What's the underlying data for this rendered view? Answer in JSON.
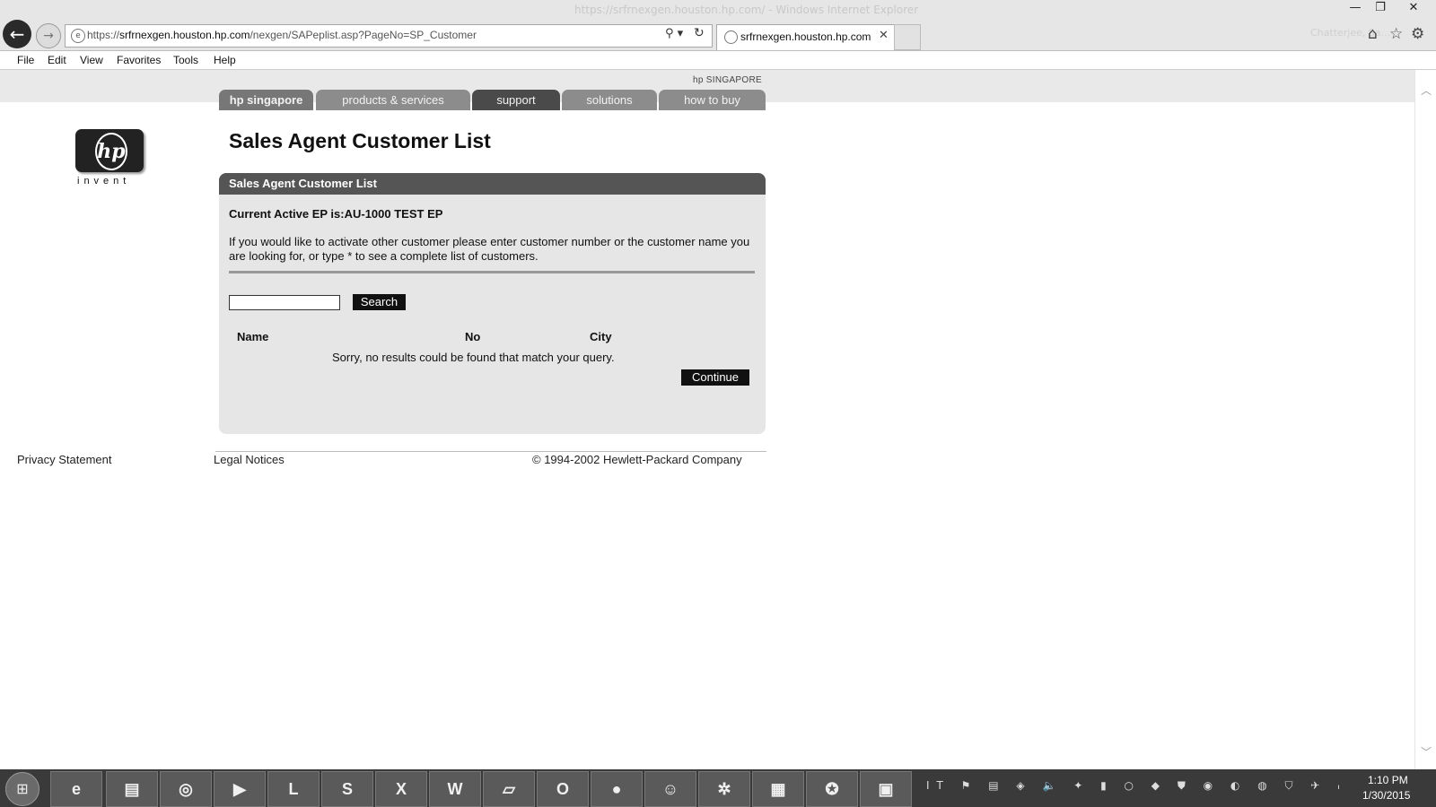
{
  "browser": {
    "window_title": "https://srfrnexgen.houston.hp.com/ - Windows Internet Explorer",
    "url_prefix": "https://",
    "url_domain": "srfrnexgen.houston.hp.com",
    "url_path": "/nexgen/SAPeplist.asp?PageNo=SP_Customer",
    "tab_title": "srfrnexgen.houston.hp.com",
    "user_name": "Chatterjee, Sa..."
  },
  "menu": {
    "file": "File",
    "edit": "Edit",
    "view": "View",
    "favorites": "Favorites",
    "tools": "Tools",
    "help": "Help"
  },
  "site": {
    "region_label": "hp SINGAPORE",
    "nav": {
      "hp_singapore": "hp singapore",
      "products_services": "products & services",
      "support": "support",
      "solutions": "solutions",
      "how_to_buy": "how to buy"
    },
    "logo_tagline": "invent"
  },
  "main": {
    "title": "Sales Agent Customer List",
    "panel_header": "Sales Agent Customer List",
    "active_ep": "Current Active EP is:AU-1000 TEST EP",
    "instructions": "If you would like to activate other customer please enter customer number or the customer name you are looking for, or type * to see a complete list of customers.",
    "search_value": "",
    "search_button": "Search",
    "columns": [
      "Name",
      "No",
      "City"
    ],
    "no_results": "Sorry, no results could be found that match your query.",
    "continue_button": "Continue"
  },
  "footer": {
    "privacy": "Privacy Statement",
    "legal": "Legal Notices",
    "copyright": "© 1994-2002 Hewlett-Packard Company"
  },
  "taskbar": {
    "apps": [
      "Internet Explorer",
      "File Explorer",
      "Chrome",
      "Media Player",
      "Lync",
      "Skype",
      "Excel",
      "Word",
      "Notepad",
      "Outlook",
      "Firefox",
      "Contacts",
      "Settings",
      "WinRAR",
      "Help",
      "Clipboard"
    ],
    "app_letters": {
      "lync": "L",
      "skype": "S",
      "excel": "X",
      "word": "W",
      "outlook": "O"
    },
    "time": "1:10 PM",
    "date": "1/30/2015"
  }
}
